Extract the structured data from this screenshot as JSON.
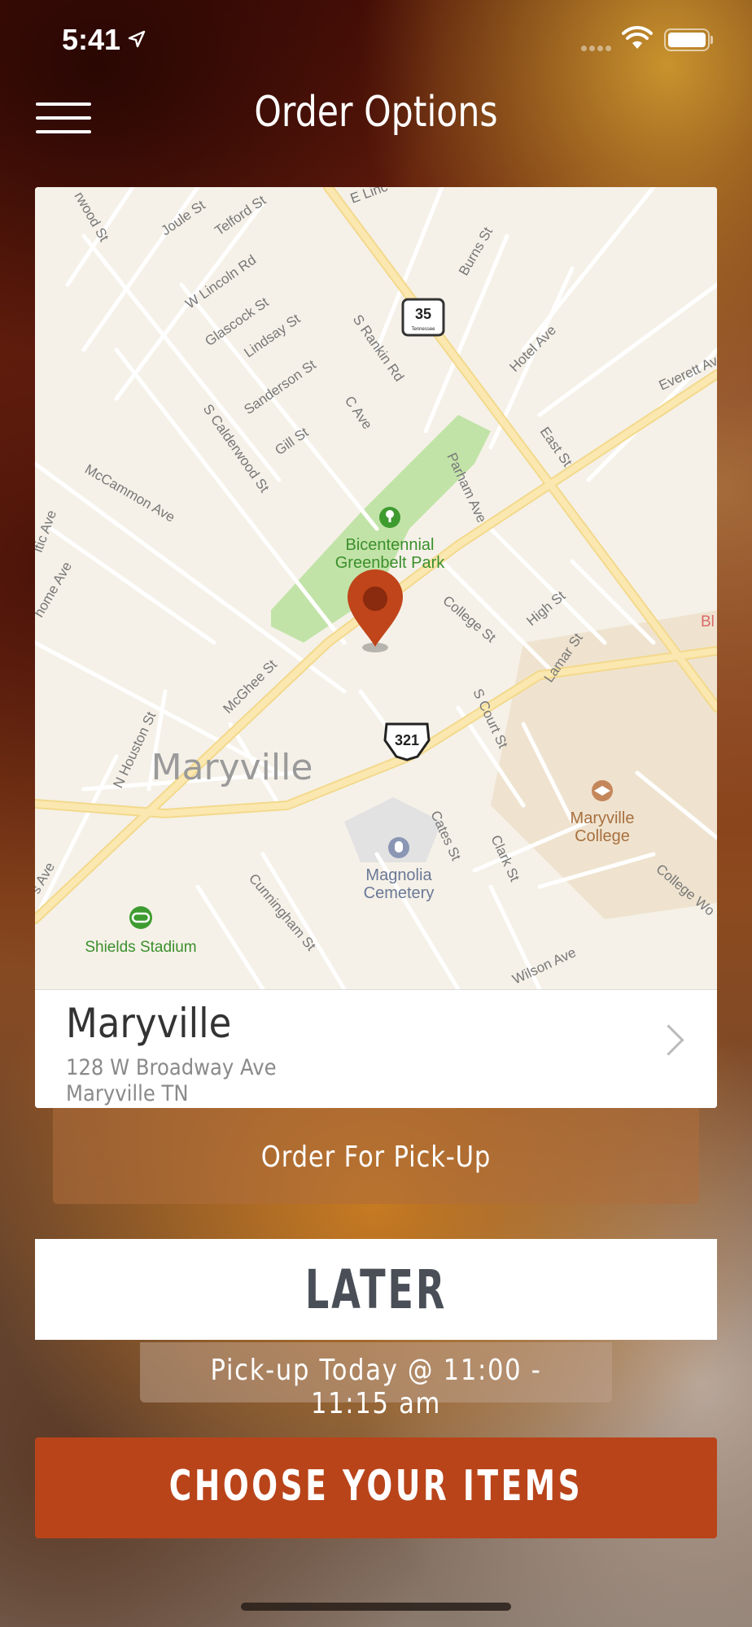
{
  "status_bar": {
    "time": "5:41",
    "icons": [
      "location-arrow-icon",
      "cellular-signal-icon",
      "wifi-icon",
      "battery-icon"
    ]
  },
  "header": {
    "title": "Order Options",
    "menu_icon": "hamburger-menu-icon"
  },
  "map": {
    "city_label": "Maryville",
    "streets": [
      "Joule St",
      "Telford St",
      "W Lincoln Rd",
      "Glascock St",
      "Lindsay St",
      "Sanderson St",
      "S Rankin Rd",
      "Gill St",
      "C Ave",
      "S Calderwood St",
      "McCammon Ave",
      "Parham Ave",
      "Burns St",
      "Hotel Ave",
      "Everett Av",
      "East St",
      "College St",
      "High St",
      "Lamar St",
      "S Court St",
      "McGhee St",
      "N Houston St",
      "Cates St",
      "Clark St",
      "Cunningham St",
      "Wilson Ave",
      "College Wo",
      "E Linc",
      "rwood St",
      "ltic Ave",
      "home Ave",
      "s Ave"
    ],
    "route_35": "35",
    "route_35_sub": "Tennessee",
    "route_321": "321",
    "pois": {
      "park_line1": "Bicentennial",
      "park_line2": "Greenbelt Park",
      "college_line1": "Maryville",
      "college_line2": "College",
      "cemetery_line1": "Magnolia",
      "cemetery_line2": "Cemetery",
      "stadium": "Shields Stadium",
      "edge_label": "Bl"
    },
    "pin_icon": "map-pin-icon"
  },
  "location": {
    "name": "Maryville",
    "address_line1": "128 W Broadway Ave",
    "address_line2": "Maryville TN",
    "chevron_icon": "chevron-right-icon"
  },
  "order_type": "Order For Pick-Up",
  "timing_button": "LATER",
  "pickup_time": "Pick-up Today @ 11:00 - 11:15 am",
  "cta_button": "CHOOSE YOUR ITEMS",
  "colors": {
    "accent": "#b9441a",
    "pin": "#c0451a",
    "park": "#c2e3a8",
    "road_major": "#fbe5a8",
    "map_bg": "#f5f1e8"
  }
}
